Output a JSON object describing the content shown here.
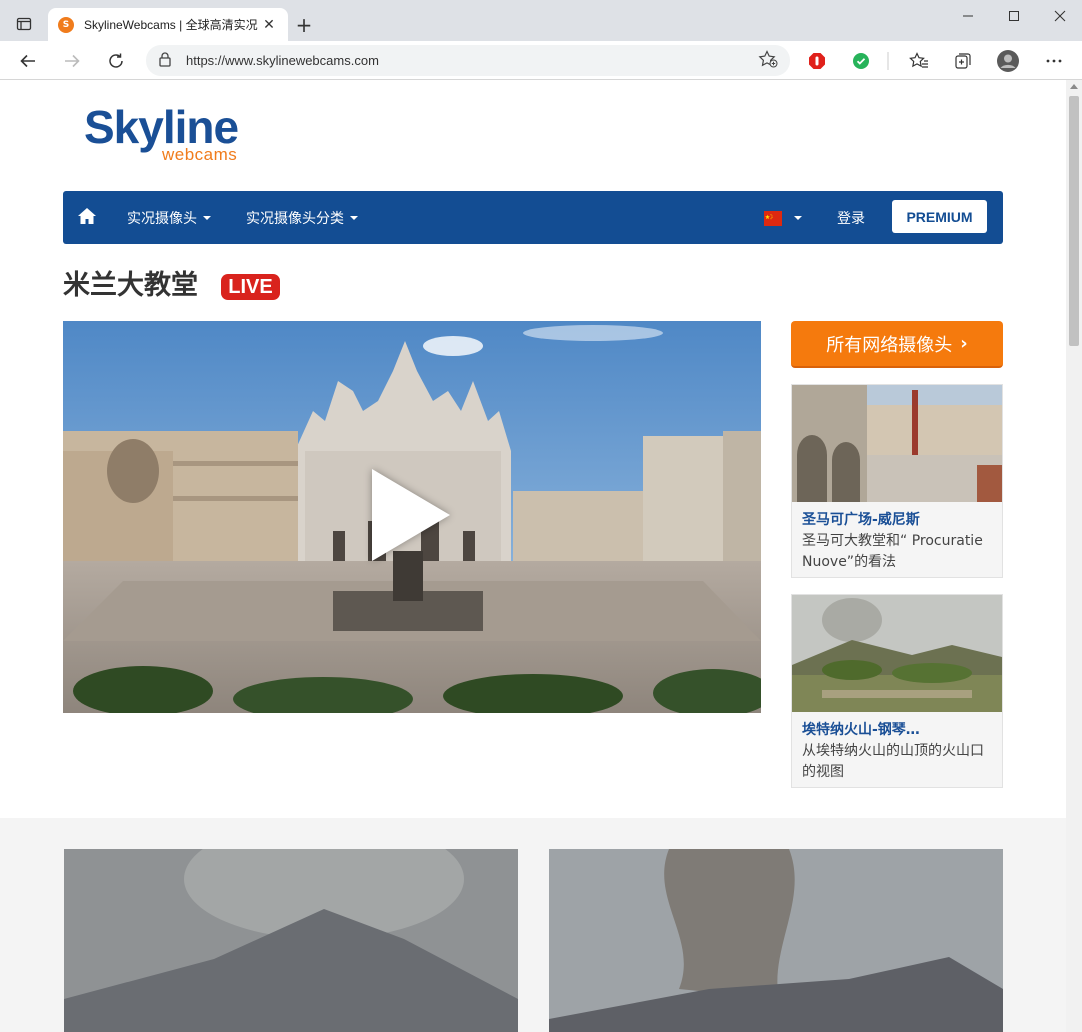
{
  "browser": {
    "tab_title": "SkylineWebcams | 全球高清实况",
    "url": "https://www.skylinewebcams.com"
  },
  "logo": {
    "primary": "Skyline",
    "secondary": "webcams"
  },
  "nav": {
    "menu1": "实况摄像头",
    "menu2": "实况摄像头分类",
    "login": "登录",
    "premium": "PREMIUM"
  },
  "page": {
    "title": "米兰大教堂",
    "live_badge": "LIVE"
  },
  "sidebar": {
    "all_cams_button": "所有网络摄像头",
    "cards": [
      {
        "title": "圣马可广场-威尼斯",
        "desc": "圣马可大教堂和“ Procuratie Nuove”的看法"
      },
      {
        "title": "埃特纳火山-钢琴…",
        "desc": "从埃特纳火山的山顶的火山口的视图"
      }
    ]
  },
  "colors": {
    "brand_blue": "#134d93",
    "brand_orange": "#f57a0d",
    "live_red": "#d9231d"
  }
}
